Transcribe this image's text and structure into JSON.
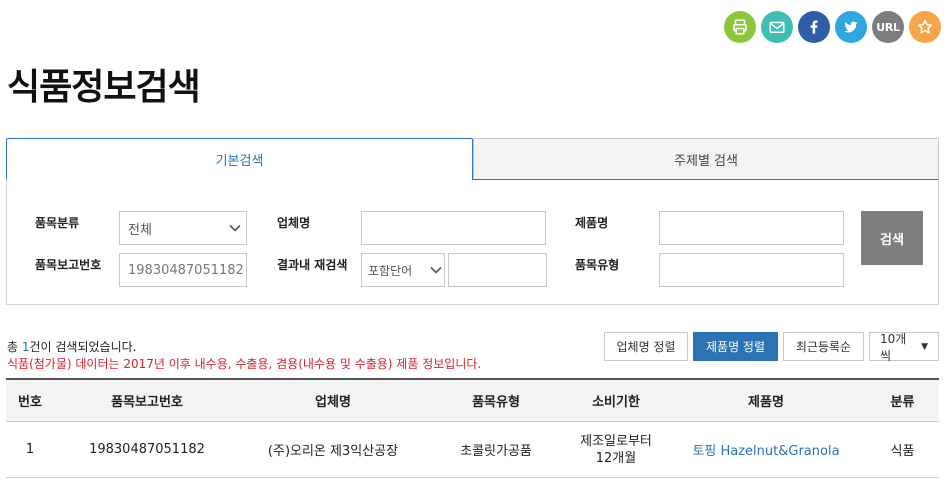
{
  "share": {
    "icons": [
      {
        "name": "print-icon",
        "color": "#8cc63f"
      },
      {
        "name": "mail-icon",
        "color": "#3fbfb3"
      },
      {
        "name": "facebook-icon",
        "color": "#2e5ea8"
      },
      {
        "name": "twitter-icon",
        "color": "#2ea6de"
      },
      {
        "name": "url-icon",
        "color": "#7d7d7d",
        "label": "URL"
      },
      {
        "name": "favorite-icon",
        "color": "#f7a54a"
      }
    ]
  },
  "page": {
    "title": "식품정보검색"
  },
  "tabs": [
    {
      "label": "기본검색",
      "active": true
    },
    {
      "label": "주제별 검색",
      "active": false
    }
  ],
  "search": {
    "category_label": "품목분류",
    "category_value": "전체",
    "report_no_label": "품목보고번호",
    "report_no_value": "19830487051182",
    "company_label": "업체명",
    "company_value": "",
    "refine_label": "결과내 재검색",
    "refine_option": "포함단어",
    "refine_value": "",
    "product_label": "제품명",
    "product_value": "",
    "type_label": "품목유형",
    "type_value": "",
    "button_label": "검색"
  },
  "results": {
    "count_prefix": "총 ",
    "count": "1",
    "count_suffix": "건이 검색되었습니다.",
    "notice": "식품(첨가물) 데이터는 2017년 이후 내수용, 수출용, 겸용(내수용 및 수출용) 제품 정보입니다."
  },
  "sort": {
    "company": "업체명 정렬",
    "product": "제품명 정렬",
    "recent": "최근등록순",
    "per_page": "10개씩"
  },
  "table": {
    "headers": [
      "번호",
      "품목보고번호",
      "업체명",
      "품목유형",
      "소비기한",
      "제품명",
      "분류"
    ],
    "rows": [
      {
        "no": "1",
        "report_no": "19830487051182",
        "company": "(주)오리온 제3익산공장",
        "type": "초콜릿가공품",
        "expiry_line1": "제조일로부터",
        "expiry_line2": "12개월",
        "product": "토핑 Hazelnut&Granola",
        "category": "식품"
      }
    ]
  }
}
